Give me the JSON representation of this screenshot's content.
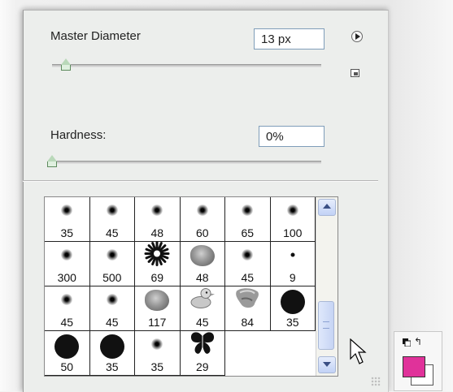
{
  "brush_panel": {
    "master_diameter": {
      "label": "Master Diameter",
      "value": "13 px",
      "slider_fraction": 0.05
    },
    "hardness": {
      "label": "Hardness:",
      "value": "0%",
      "slider_fraction": 0.0
    }
  },
  "presets": [
    {
      "size": "35",
      "icon": "soft-round-brush"
    },
    {
      "size": "45",
      "icon": "soft-round-brush"
    },
    {
      "size": "48",
      "icon": "soft-round-brush"
    },
    {
      "size": "60",
      "icon": "soft-round-brush"
    },
    {
      "size": "65",
      "icon": "soft-round-brush"
    },
    {
      "size": "100",
      "icon": "soft-round-brush"
    },
    {
      "size": "300",
      "icon": "soft-round-brush"
    },
    {
      "size": "500",
      "icon": "soft-round-brush"
    },
    {
      "size": "69",
      "icon": "starburst-brush"
    },
    {
      "size": "48",
      "icon": "rose-brush"
    },
    {
      "size": "45",
      "icon": "soft-round-brush"
    },
    {
      "size": "9",
      "icon": "small-round-brush"
    },
    {
      "size": "45",
      "icon": "soft-round-brush"
    },
    {
      "size": "45",
      "icon": "soft-round-brush"
    },
    {
      "size": "117",
      "icon": "rose-brush"
    },
    {
      "size": "45",
      "icon": "duck-brush"
    },
    {
      "size": "84",
      "icon": "texture-brush"
    },
    {
      "size": "35",
      "icon": "hard-round-brush"
    },
    {
      "size": "50",
      "icon": "hard-round-brush"
    },
    {
      "size": "35",
      "icon": "hard-round-brush"
    },
    {
      "size": "35",
      "icon": "soft-round-brush"
    },
    {
      "size": "29",
      "icon": "butterfly-brush"
    }
  ],
  "colors": {
    "foreground": "#e0329a",
    "background": "#ffffff"
  }
}
